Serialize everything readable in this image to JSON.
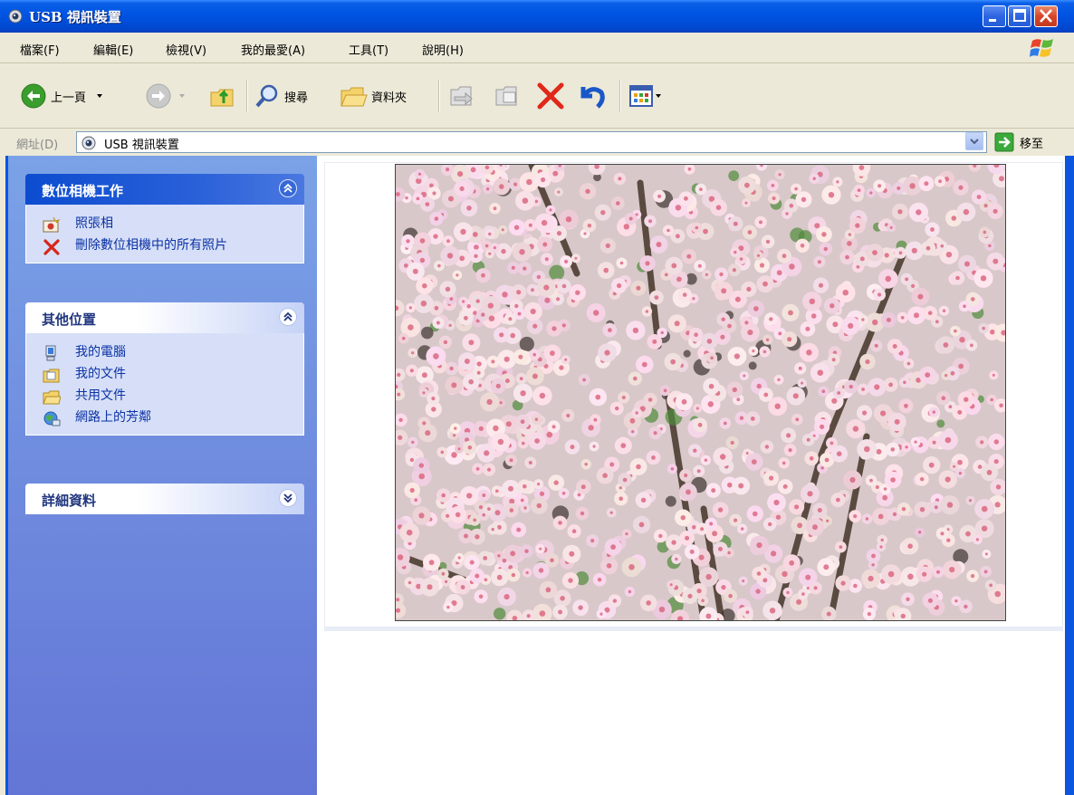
{
  "window": {
    "title": "USB 視訊裝置"
  },
  "menu": [
    "檔案(F)",
    "編輯(E)",
    "檢視(V)",
    "我的最愛(A)",
    "工具(T)",
    "說明(H)"
  ],
  "toolbar": {
    "back": "上一頁",
    "search": "搜尋",
    "folders": "資料夾"
  },
  "address": {
    "label": "網址(D)",
    "value": "USB 視訊裝置",
    "go": "移至"
  },
  "panels": {
    "camera_tasks": {
      "title": "數位相機工作",
      "items": [
        "照張相",
        "刪除數位相機中的所有照片"
      ]
    },
    "other_places": {
      "title": "其他位置",
      "items": [
        "我的電腦",
        "我的文件",
        "共用文件",
        "網路上的芳鄰"
      ]
    },
    "details": {
      "title": "詳細資料"
    }
  },
  "colors": {
    "titlebar": "#0054e3",
    "taskpane_gradient_top": "#7ba2e7",
    "taskpane_gradient_bottom": "#6375d6",
    "link": "#0c32a6"
  },
  "icons": {
    "titlebar": "webcam-icon",
    "tasks": [
      "camera-take-picture-icon",
      "delete-x-icon"
    ],
    "places": [
      "my-computer-icon",
      "my-documents-icon",
      "shared-folder-icon",
      "network-places-icon"
    ]
  }
}
